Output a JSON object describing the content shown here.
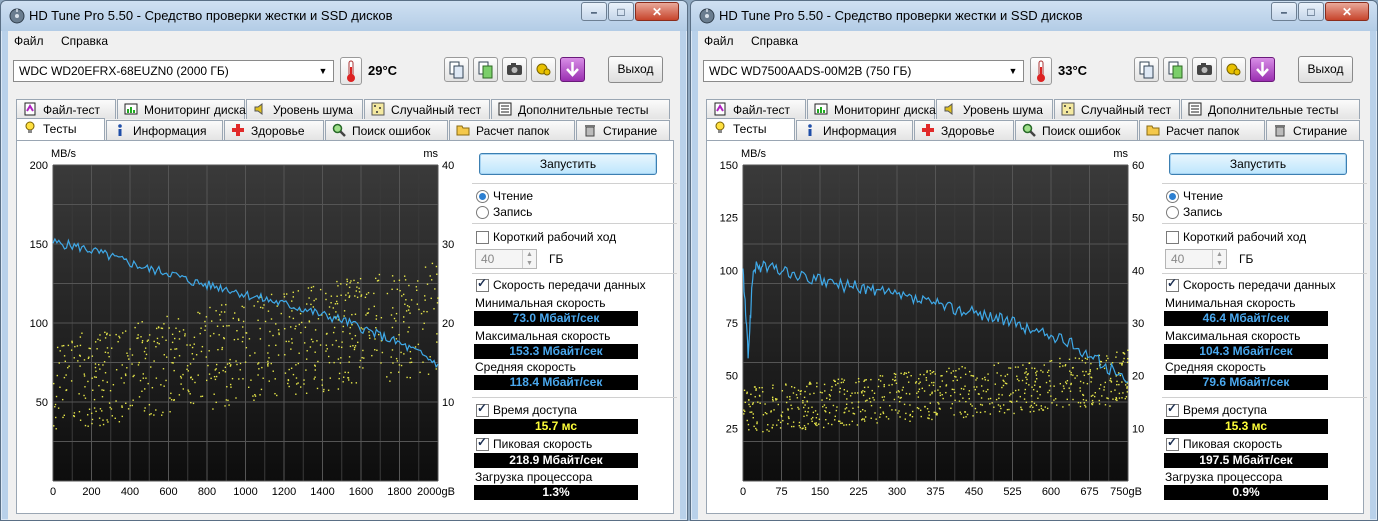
{
  "windows": [
    {
      "title": "HD Tune Pro 5.50 - Средство проверки жестки и SSD дисков",
      "menu": [
        "Файл",
        "Справка"
      ],
      "drive": "WDC WD20EFRX-68EUZN0 (2000 ГБ)",
      "temperature": "29°C",
      "exit_label": "Выход",
      "tabs_top": [
        "Файл-тест",
        "Мониторинг диска",
        "Уровень шума",
        "Случайный тест",
        "Дополнительные тесты"
      ],
      "tabs_bottom": [
        "Тесты",
        "Информация",
        "Здоровье",
        "Поиск ошибок",
        "Расчет папок",
        "Стирание"
      ],
      "active_tab": "Тесты",
      "start_label": "Запустить",
      "read_label": "Чтение",
      "write_label": "Запись",
      "read_selected": true,
      "short_stroke_label": "Короткий рабочий ход",
      "short_stroke_checked": false,
      "short_stroke_value": "40",
      "short_stroke_unit": "ГБ",
      "transfer_rate_label": "Скорость передачи данных",
      "transfer_rate_checked": true,
      "min_label": "Минимальная скорость",
      "min_value": "73.0 Мбайт/сек",
      "max_label": "Максимальная скорость",
      "max_value": "153.3 Мбайт/сек",
      "avg_label": "Средняя скорость",
      "avg_value": "118.4 Мбайт/сек",
      "access_label": "Время доступа",
      "access_checked": true,
      "access_value": "15.7 мс",
      "burst_label": "Пиковая скорость",
      "burst_checked": true,
      "burst_value": "218.9 Мбайт/сек",
      "cpu_label": "Загрузка процессора",
      "cpu_value": "1.3%",
      "chart_data": {
        "type": "line",
        "left_axis_label": "MB/s",
        "right_axis_label": "ms",
        "x_unit": "gB",
        "xlim": [
          0,
          2000
        ],
        "ylim": [
          0,
          200
        ],
        "y2lim": [
          0,
          40
        ],
        "x_ticks": [
          "0",
          "200",
          "400",
          "600",
          "800",
          "1000",
          "1200",
          "1400",
          "1600",
          "1800",
          "2000gB"
        ],
        "y_ticks": [
          "200",
          "150",
          "100",
          "50"
        ],
        "y2_ticks": [
          "40",
          "30",
          "20",
          "10"
        ],
        "transfer_series": {
          "name": "Transfer rate",
          "color": "#3fa9e8",
          "x": [
            0,
            100,
            200,
            300,
            400,
            500,
            600,
            700,
            800,
            900,
            1000,
            1100,
            1200,
            1300,
            1400,
            1500,
            1600,
            1700,
            1800,
            1900,
            2000
          ],
          "y": [
            151,
            149,
            146,
            142,
            138,
            134,
            132,
            127,
            124,
            122,
            118,
            115,
            112,
            109,
            105,
            102,
            97,
            92,
            87,
            81,
            74
          ]
        },
        "access_series": {
          "name": "Access time",
          "color": "#e8e84a",
          "x_range": [
            0,
            2000
          ],
          "y_range_ms": [
            6,
            28
          ]
        }
      }
    },
    {
      "title": "HD Tune Pro 5.50 - Средство проверки жестки и SSD дисков",
      "menu": [
        "Файл",
        "Справка"
      ],
      "drive": "WDC WD7500AADS-00M2B (750 ГБ)",
      "temperature": "33°C",
      "exit_label": "Выход",
      "tabs_top": [
        "Файл-тест",
        "Мониторинг диска",
        "Уровень шума",
        "Случайный тест",
        "Дополнительные тесты"
      ],
      "tabs_bottom": [
        "Тесты",
        "Информация",
        "Здоровье",
        "Поиск ошибок",
        "Расчет папок",
        "Стирание"
      ],
      "active_tab": "Тесты",
      "start_label": "Запустить",
      "read_label": "Чтение",
      "write_label": "Запись",
      "read_selected": true,
      "short_stroke_label": "Короткий рабочий ход",
      "short_stroke_checked": false,
      "short_stroke_value": "40",
      "short_stroke_unit": "ГБ",
      "transfer_rate_label": "Скорость передачи данных",
      "transfer_rate_checked": true,
      "min_label": "Минимальная скорость",
      "min_value": "46.4 Мбайт/сек",
      "max_label": "Максимальная скорость",
      "max_value": "104.3 Мбайт/сек",
      "avg_label": "Средняя скорость",
      "avg_value": "79.6 Мбайт/сек",
      "access_label": "Время доступа",
      "access_checked": true,
      "access_value": "15.3 мс",
      "burst_label": "Пиковая скорость",
      "burst_checked": true,
      "burst_value": "197.5 Мбайт/сек",
      "cpu_label": "Загрузка процессора",
      "cpu_value": "0.9%",
      "chart_data": {
        "type": "line",
        "left_axis_label": "MB/s",
        "right_axis_label": "ms",
        "x_unit": "gB",
        "xlim": [
          0,
          750
        ],
        "ylim": [
          0,
          150
        ],
        "y2lim": [
          0,
          60
        ],
        "x_ticks": [
          "0",
          "75",
          "150",
          "225",
          "300",
          "375",
          "450",
          "525",
          "600",
          "675",
          "750gB"
        ],
        "y_ticks": [
          "150",
          "125",
          "100",
          "75",
          "50",
          "25"
        ],
        "y2_ticks": [
          "60",
          "50",
          "40",
          "30",
          "20",
          "10"
        ],
        "transfer_series": {
          "name": "Transfer rate",
          "color": "#3fa9e8",
          "x": [
            0,
            10,
            20,
            40,
            75,
            110,
            150,
            190,
            225,
            260,
            300,
            340,
            375,
            410,
            450,
            490,
            525,
            560,
            600,
            640,
            675,
            710,
            750
          ],
          "y": [
            100,
            60,
            101,
            102,
            100,
            97,
            95,
            93,
            92,
            90,
            88,
            86,
            84,
            82,
            80,
            78,
            75,
            72,
            69,
            65,
            60,
            54,
            47
          ]
        },
        "access_series": {
          "name": "Access time",
          "color": "#e8e84a",
          "x_range": [
            0,
            750
          ],
          "y_range_ms": [
            9,
            25
          ]
        }
      }
    }
  ]
}
